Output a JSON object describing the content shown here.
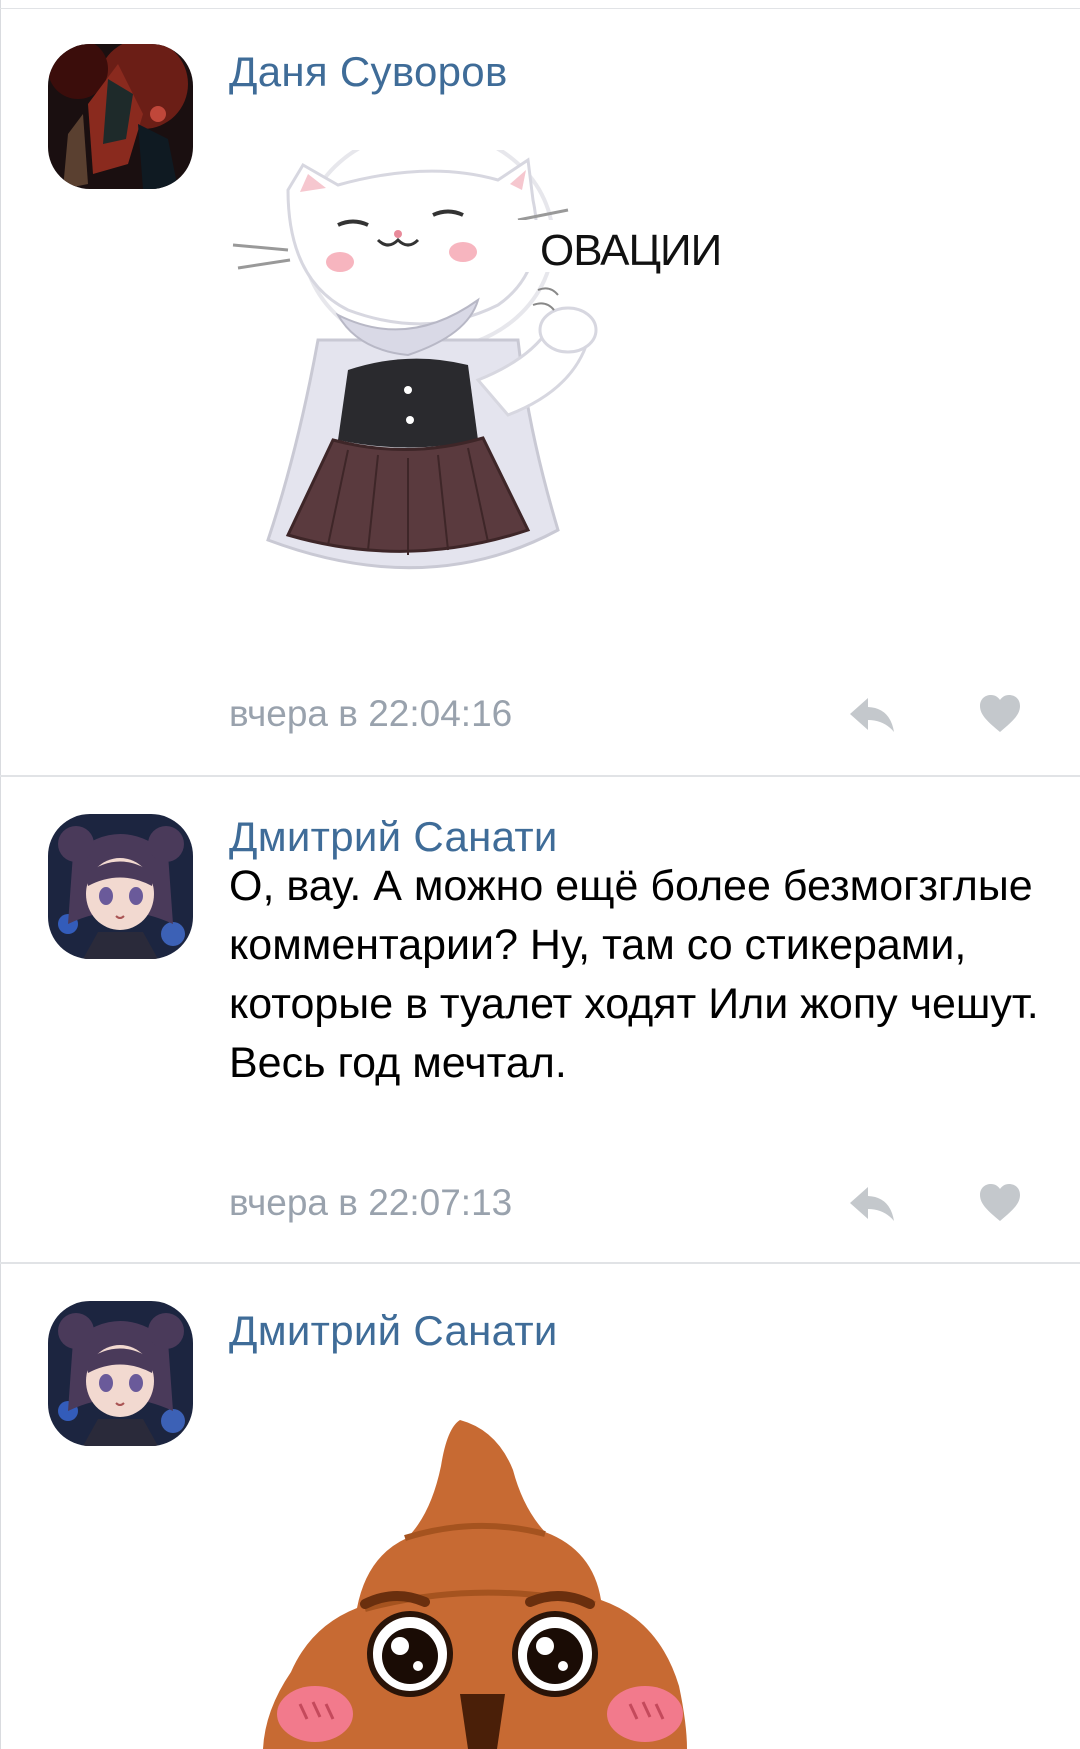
{
  "comments": [
    {
      "author": "Даня Суворов",
      "sticker_text": "ОВАЦИИ",
      "time": "вчера в 22:04:16",
      "sticker_icon": "cat-applause-sticker",
      "avatar_icon": "dark-art-avatar"
    },
    {
      "author": "Дмитрий Санати",
      "text": "О, вау. А можно ещё более безмогзглые комментарии? Ну, там со стикерами, которые в туалет ходят Или жопу чешут. Весь год мечтал.",
      "time": "вчера в 22:07:13",
      "avatar_icon": "anime-girl-avatar"
    },
    {
      "author": "Дмитрий Санати",
      "sticker_icon": "poop-sticker",
      "avatar_icon": "anime-girl-avatar"
    }
  ],
  "colors": {
    "author": "#3f6c98",
    "meta": "#99a2ad",
    "icon": "#c4c8cc",
    "divider": "#e1e3e6"
  },
  "icons": {
    "reply": "reply-arrow-icon",
    "like": "heart-icon"
  }
}
